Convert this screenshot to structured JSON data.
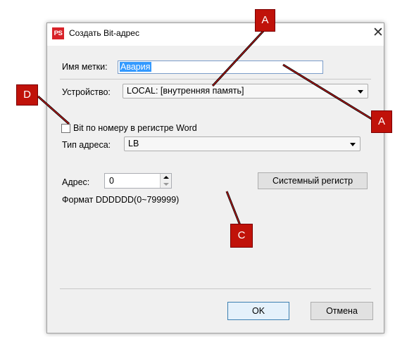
{
  "dialog": {
    "app_icon_text": "PS",
    "title": "Создать Bit-адрес",
    "close_glyph": "✕"
  },
  "form": {
    "tag_name_label": "Имя метки:",
    "tag_name_value": "Авария",
    "device_label": "Устройство:",
    "device_value": "LOCAL: [внутренняя память]",
    "bit_by_word_label": "Bit по номеру в регистре Word",
    "bit_by_word_checked": false,
    "address_type_label": "Тип адреса:",
    "address_type_value": "LB",
    "address_label": "Адрес:",
    "address_value": "0",
    "system_register_button": "Системный регистр",
    "format_text": "Формат DDDDDD(0~799999)"
  },
  "buttons": {
    "ok": "OK",
    "cancel": "Отмена"
  },
  "callouts": {
    "a_top": "A",
    "a_right": "A",
    "c": "C",
    "d": "D"
  },
  "colors": {
    "callout": "#c0120a",
    "selection": "#3399ff",
    "focus_border": "#3c7fb1"
  }
}
